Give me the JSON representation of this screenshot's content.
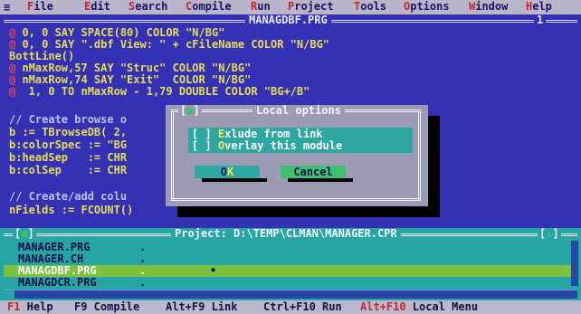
{
  "menu": {
    "system_glyph": "≡",
    "items": [
      {
        "label": "File",
        "hotkey": "F",
        "rest": "ile"
      },
      {
        "label": "Edit",
        "hotkey": "E",
        "rest": "dit"
      },
      {
        "label": "Search",
        "hotkey": "S",
        "rest": "earch"
      },
      {
        "label": "Compile",
        "hotkey": "C",
        "rest": "ompile"
      },
      {
        "label": "Run",
        "hotkey": "R",
        "rest": "un"
      },
      {
        "label": "Project",
        "hotkey": "P",
        "rest": "roject"
      },
      {
        "label": "Tools",
        "hotkey": "T",
        "rest": "ools"
      },
      {
        "label": "Options",
        "hotkey": "O",
        "rest": "ptions"
      },
      {
        "label": "Window",
        "hotkey": "W",
        "rest": "indow"
      },
      {
        "label": "Help",
        "hotkey": "H",
        "rest": "elp"
      }
    ]
  },
  "editor": {
    "filename": "MANAGDBF.PRG",
    "window_number": "1",
    "lines": [
      {
        "bullet": "@",
        "text": " 0, 0 SAY SPACE(80) COLOR \"N/BG\""
      },
      {
        "bullet": "@",
        "text": " 0, 0 SAY \".dbf View: \" + cFileName COLOR \"N/BG\""
      },
      {
        "bullet": "",
        "text": "BottLine()"
      },
      {
        "bullet": "@",
        "text": " nMaxRow,57 SAY \"Struc\" COLOR \"N/BG\""
      },
      {
        "bullet": "@",
        "text": " nMaxRow,74 SAY \"Exit\"  COLOR \"N/BG\""
      },
      {
        "bullet": "@",
        "text": "  1, 0 TO nMaxRow - 1,79 DOUBLE COLOR \"BG+/B\""
      },
      {
        "bullet": "",
        "text": ""
      },
      {
        "bullet": "",
        "text": "// Create browse o"
      },
      {
        "bullet": "",
        "text": "b := TBrowseDB( 2,"
      },
      {
        "bullet": "",
        "text": "b:colorSpec := \"BG"
      },
      {
        "bullet": "",
        "text": "b:headSep   := CHR"
      },
      {
        "bullet": "",
        "text": "b:colSep    := CHR"
      },
      {
        "bullet": "",
        "text": ""
      },
      {
        "bullet": "",
        "text": "// Create/add colu"
      },
      {
        "bullet": "",
        "text": "nFields := FCOUNT()"
      }
    ]
  },
  "dialog": {
    "title": "Local options",
    "close_glyph": "■",
    "checkboxes": [
      {
        "mark": "[ ]",
        "hotkey": "E",
        "rest": "xlude from link",
        "checked": false
      },
      {
        "mark": "[ ]",
        "hotkey": "O",
        "rest": "verlay this module",
        "checked": false
      }
    ],
    "ok_label_pre": "O",
    "ok_label_hot": "K",
    "cancel_label": "Cancel"
  },
  "project": {
    "title": "Project: D:\\TEMP\\CLMAN\\MANAGER.CPR",
    "close_glyph": "■",
    "zoom_glyph": "↕",
    "files": [
      {
        "name": "MANAGER.PRG",
        "mark": ".",
        "selected": false
      },
      {
        "name": "MANAGER.CH",
        "mark": ".",
        "selected": false
      },
      {
        "name": "MANAGDBF.PRG",
        "mark": ".",
        "selected": true
      },
      {
        "name": "MANAGDCR.PRG",
        "mark": ".",
        "selected": false
      }
    ],
    "selected_extra_mark": "•"
  },
  "statusbar": {
    "items": [
      {
        "key": "F1",
        "label": " Help"
      },
      {
        "key": "F9",
        "label": " Compile"
      },
      {
        "key": "Alt+F9",
        "label": " Link"
      },
      {
        "key": "Ctrl+F10",
        "label": " Run"
      },
      {
        "key": "Alt+F10",
        "label": " Local Menu"
      }
    ]
  },
  "colors": {
    "editor_bg": "#3431b5",
    "code_text": "#e7dd55",
    "bullet_red": "#ef3d55",
    "dialog_bg": "#9c9bb5",
    "project_bg": "#27a5a5",
    "selected_row": "#7cc23c",
    "menu_bg": "#b9b4c9"
  }
}
